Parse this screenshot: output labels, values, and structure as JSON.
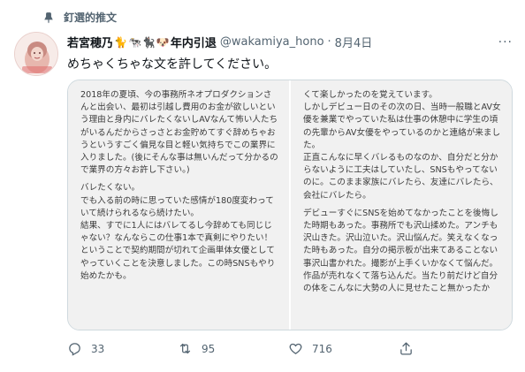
{
  "pinned_label": "釘選的推文",
  "author": {
    "name": "若宮穂乃",
    "emoji": [
      "🐈",
      "🐄",
      "🐈‍⬛",
      "🐶"
    ],
    "name_suffix": "年内引退",
    "handle": "@wakamiya_hono",
    "separator": "·",
    "date": "8月4日"
  },
  "more_label": "···",
  "tweet_text": "めちゃくちゃな文を許してください。",
  "image": {
    "left_paragraphs": [
      "2018年の夏頃、今の事務所ネオプロダクションさんと出会い、最初は引越し費用のお金が欲しいという理由と身内にバレたくないしAVなんて怖い人たちがいるんだからさっさとお金貯めてすぐ辞めちゃおうというすごく偏見な目と軽い気持ちでこの業界に入りました。(後にそんな事は無いんだって分かるので業界の方々お許し下さい。)",
      "バレたくない。\nでも入る前の時に思っていた感情が180度変わっていて続けられるなら続けたい。\n結果、すでに1人にはバレてるし今辞めても同じじゃない？なんならこの仕事1本で真剣にやりたい！ということで契約期間が切れて企画単体女優としてやっていくことを決意しました。この時SNSもやり始めたかも。"
    ],
    "right_paragraphs": [
      "くて楽しかったのを覚えています。\nしかしデビュー日のその次の日、当時一般職とAV女優を兼業でやっていた私は仕事の休憩中に学生の頃の先輩からAV女優をやっているのかと連絡が来ました。\n正直こんなに早くバレるものなのか、自分だと分からないように工夫はしていたし、SNSもやってないのに。このまま家族にバレたら、友達にバレたら、会社にバレたら。",
      "デビューすぐにSNSを始めてなかったことを後悔した時期もあった。事務所でも沢山揉めた。アンチも沢山きた。沢山泣いた。沢山悩んだ。笑えなくなった時もあった。自分の掲示板が出来てあることない事沢山書かれた。撮影が上手くいかなくて悩んだ。作品が売れなくて落ち込んだ。当たり前だけど自分の体をこんなに大勢の人に見せたこと無かったか"
    ]
  },
  "actions": {
    "replies": "33",
    "retweets": "95",
    "likes": "716"
  },
  "colors": {
    "text": "#0f1419",
    "secondary": "#536471",
    "border": "#cfd9de"
  }
}
